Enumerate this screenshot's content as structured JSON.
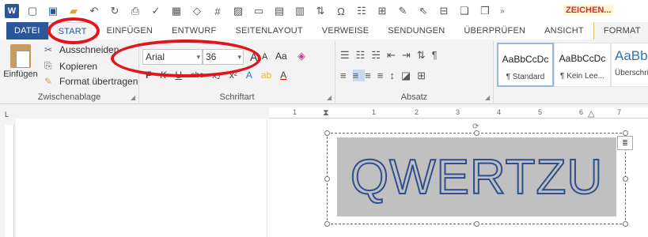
{
  "quick_access": {
    "zeichen_tab": "ZEICHEN..."
  },
  "tabs": [
    {
      "label": "DATEI"
    },
    {
      "label": "START"
    },
    {
      "label": "EINFÜGEN"
    },
    {
      "label": "ENTWURF"
    },
    {
      "label": "SEITENLAYOUT"
    },
    {
      "label": "VERWEISE"
    },
    {
      "label": "SENDUNGEN"
    },
    {
      "label": "ÜBERPRÜFEN"
    },
    {
      "label": "ANSICHT"
    },
    {
      "label": "FORMAT"
    }
  ],
  "clipboard": {
    "paste_label": "Einfügen",
    "cut_label": "Ausschneiden",
    "copy_label": "Kopieren",
    "format_painter_label": "Format übertragen",
    "group_label": "Zwischenablage"
  },
  "font": {
    "font_name": "Arial",
    "font_size": "36",
    "group_label": "Schriftart",
    "aa_label": "Aa",
    "bold": "F",
    "italic": "K",
    "underline": "U",
    "strike": "abc",
    "subscript": "x₂",
    "superscript": "x²",
    "text_effect": "A",
    "font_color": "A"
  },
  "paragraph": {
    "group_label": "Absatz"
  },
  "styles": [
    {
      "sample": "AaBbCcDc",
      "name": "¶ Standard"
    },
    {
      "sample": "AaBbCcDc",
      "name": "¶ Kein Lee..."
    },
    {
      "sample": "AaBbC",
      "name": "Überschrif"
    }
  ],
  "ruler_numbers": [
    "1",
    "1",
    "2",
    "3",
    "4",
    "5",
    "6",
    "7"
  ],
  "document": {
    "wordart_text": "QWERTZU"
  },
  "colors": {
    "accent": "#2b579a",
    "annotation": "#e0161c",
    "wordart_fill": "#c0c0c0",
    "wordart_outline": "#2f4f8f"
  }
}
